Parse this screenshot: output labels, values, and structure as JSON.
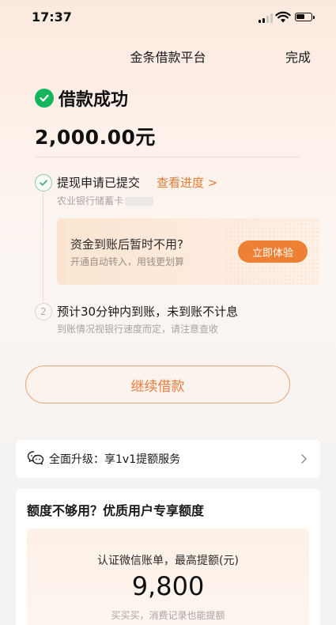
{
  "status_bar": {
    "time": "17:37"
  },
  "nav": {
    "title": "金条借款平台",
    "done_label": "完成"
  },
  "result": {
    "status_text": "借款成功",
    "amount": "2,000.00元"
  },
  "steps": [
    {
      "index": "1",
      "title": "提现申请已提交",
      "link_label": "查看进度 >",
      "subtitle": "农业银行储蓄卡",
      "state": "done"
    },
    {
      "index": "2",
      "title": "预计30分钟内到账，未到账不计息",
      "subtitle": "到账情况视银行速度而定，请注意查收",
      "state": "pending"
    }
  ],
  "promo": {
    "title": "资金到账后暂时不用?",
    "subtitle": "开通自动转入，用钱更划算",
    "button_label": "立即体验"
  },
  "continue_button": {
    "label": "继续借款"
  },
  "upgrade": {
    "text": "全面升级：享1v1提额服务"
  },
  "quota": {
    "title": "额度不够用？优质用户专享额度",
    "label": "认证微信账单，最高提额(元)",
    "amount": "9,800",
    "note": "买买买，消费记录也能提额"
  },
  "colors": {
    "accent": "#ee8033",
    "success": "#16b65c",
    "link": "#e37b33"
  }
}
